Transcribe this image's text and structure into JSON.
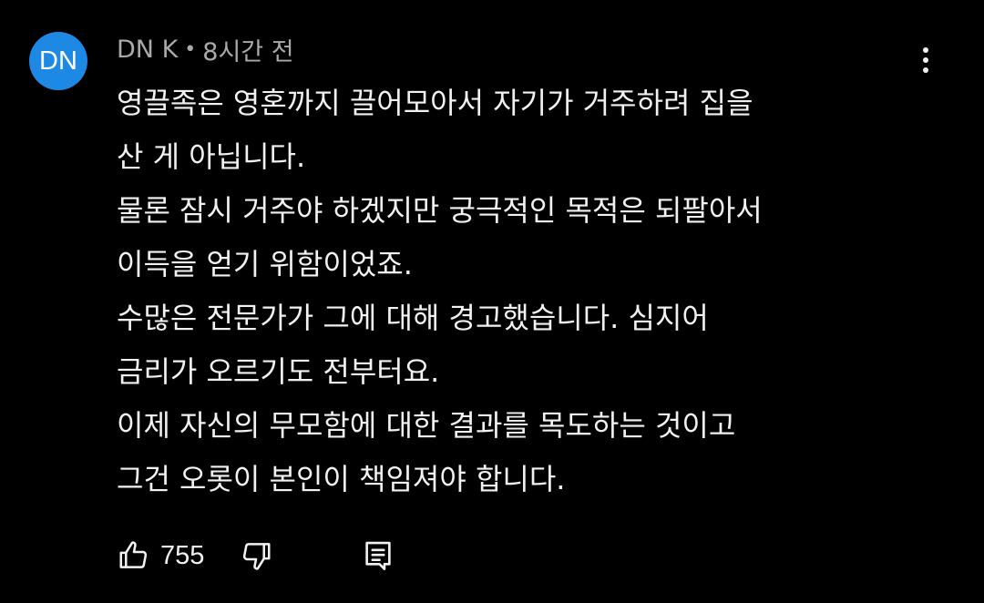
{
  "comment": {
    "avatar_initials": "DN",
    "avatar_color": "#1e88e5",
    "author": "DN K",
    "separator": "•",
    "time_ago": "8시간 전",
    "lines": [
      "영끌족은 영혼까지 끌어모아서 자기가 거주하려 집을",
      "산 게 아닙니다.",
      "물론 잠시 거주야 하겠지만 궁극적인 목적은 되팔아서",
      "이득을 얻기 위함이었죠.",
      "수많은 전문가가 그에 대해 경고했습니다. 심지어",
      "금리가 오르기도 전부터요.",
      "이제 자신의 무모함에 대한 결과를 목도하는 것이고",
      "그건 오롯이 본인이 책임져야 합니다."
    ],
    "like_count": "755"
  },
  "icons": {
    "more": "more-vertical-icon",
    "like": "thumbs-up-icon",
    "dislike": "thumbs-down-icon",
    "reply": "reply-comment-icon"
  },
  "colors": {
    "background": "#000000",
    "text": "#f1f1f1",
    "meta": "#aaaaaa"
  }
}
